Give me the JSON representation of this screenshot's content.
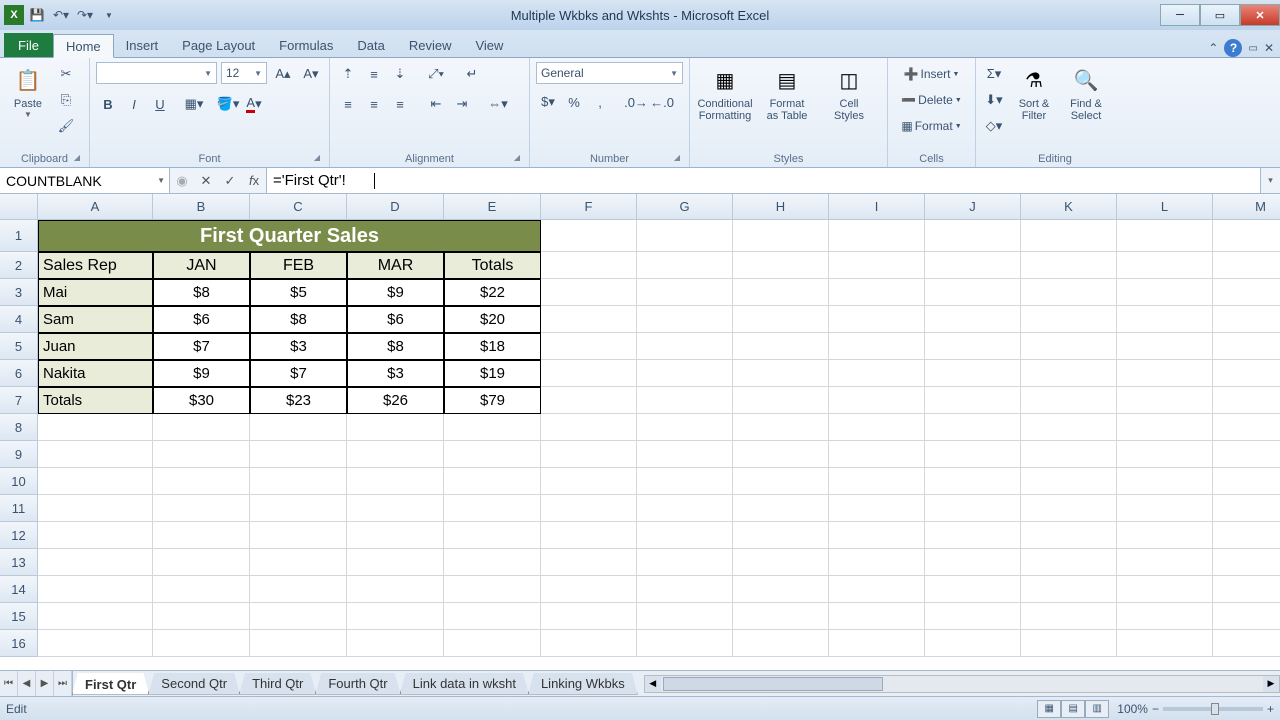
{
  "window": {
    "title": "Multiple Wkbks and Wkshts - Microsoft Excel"
  },
  "tabs": {
    "file": "File",
    "list": [
      "Home",
      "Insert",
      "Page Layout",
      "Formulas",
      "Data",
      "Review",
      "View"
    ],
    "active": "Home"
  },
  "ribbon": {
    "clipboard": {
      "paste": "Paste",
      "label": "Clipboard"
    },
    "font": {
      "size": "12",
      "label": "Font"
    },
    "alignment": {
      "label": "Alignment"
    },
    "number": {
      "format": "General",
      "label": "Number"
    },
    "styles": {
      "cond": "Conditional\nFormatting",
      "table": "Format\nas Table",
      "cell": "Cell\nStyles",
      "label": "Styles"
    },
    "cells": {
      "insert": "Insert",
      "delete": "Delete",
      "format": "Format",
      "label": "Cells"
    },
    "editing": {
      "sort": "Sort &\nFilter",
      "find": "Find &\nSelect",
      "label": "Editing"
    }
  },
  "formula": {
    "namebox": "COUNTBLANK",
    "content": "='First Qtr'!"
  },
  "columns": [
    "A",
    "B",
    "C",
    "D",
    "E",
    "F",
    "G",
    "H",
    "I",
    "J",
    "K",
    "L",
    "M"
  ],
  "chart_data": {
    "type": "table",
    "title": "First Quarter Sales",
    "headers": [
      "Sales Rep",
      "JAN",
      "FEB",
      "MAR",
      "Totals"
    ],
    "rows": [
      [
        "Mai",
        "$8",
        "$5",
        "$9",
        "$22"
      ],
      [
        "Sam",
        "$6",
        "$8",
        "$6",
        "$20"
      ],
      [
        "Juan",
        "$7",
        "$3",
        "$8",
        "$18"
      ],
      [
        "Nakita",
        "$9",
        "$7",
        "$3",
        "$19"
      ],
      [
        "Totals",
        "$30",
        "$23",
        "$26",
        "$79"
      ]
    ]
  },
  "sheets": [
    "First Qtr",
    "Second Qtr",
    "Third Qtr",
    "Fourth Qtr",
    "Link data in wksht",
    "Linking Wkbks"
  ],
  "status": {
    "mode": "Edit",
    "zoom": "100%"
  }
}
